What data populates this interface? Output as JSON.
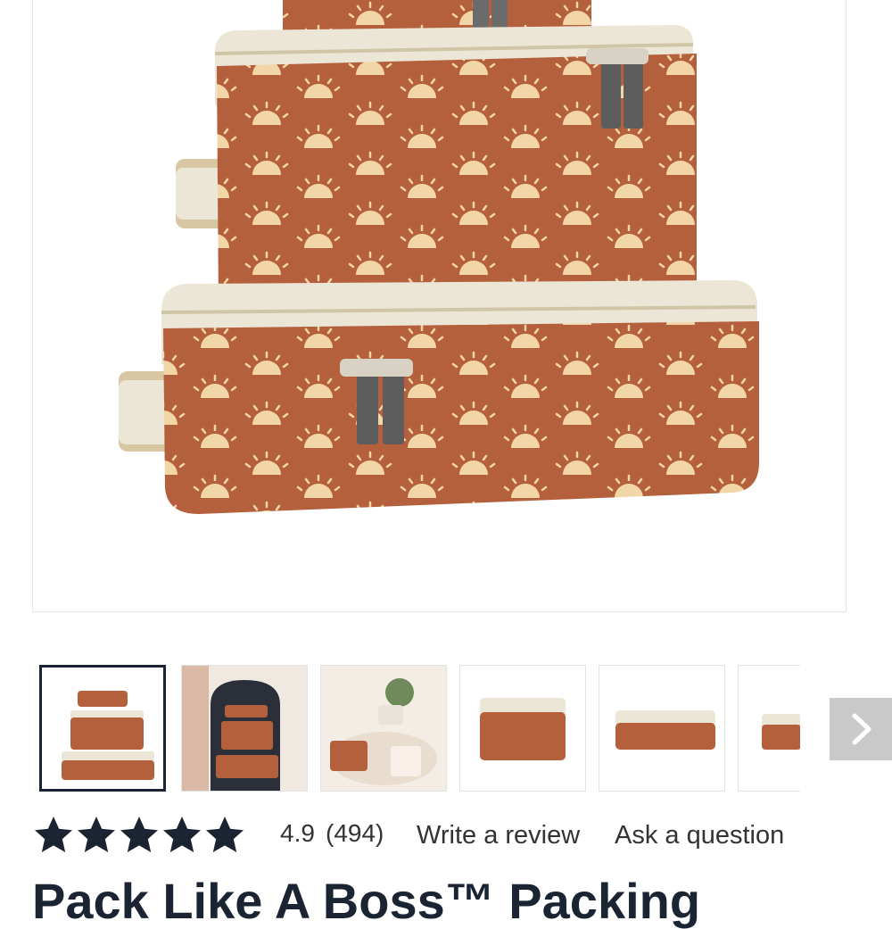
{
  "main_image": {
    "alt": "Packing cubes with sunrise pattern"
  },
  "thumbnails": [
    {
      "name": "thumbnail-1",
      "selected": true
    },
    {
      "name": "thumbnail-2",
      "selected": false
    },
    {
      "name": "thumbnail-3",
      "selected": false
    },
    {
      "name": "thumbnail-4",
      "selected": false
    },
    {
      "name": "thumbnail-5",
      "selected": false
    },
    {
      "name": "thumbnail-6",
      "selected": false
    }
  ],
  "thumbnail_next": {
    "icon": "chevron-right-icon"
  },
  "rating": {
    "stars": 5,
    "value": "4.9",
    "count": "(494)"
  },
  "links": {
    "write_review": "Write a review",
    "ask_question": "Ask a question"
  },
  "product": {
    "title": "Pack Like A Boss™ Packing"
  },
  "colors": {
    "rust": "#b5603c",
    "cream": "#ece6d6",
    "navy": "#1b2433",
    "gold": "#c8a86b"
  }
}
